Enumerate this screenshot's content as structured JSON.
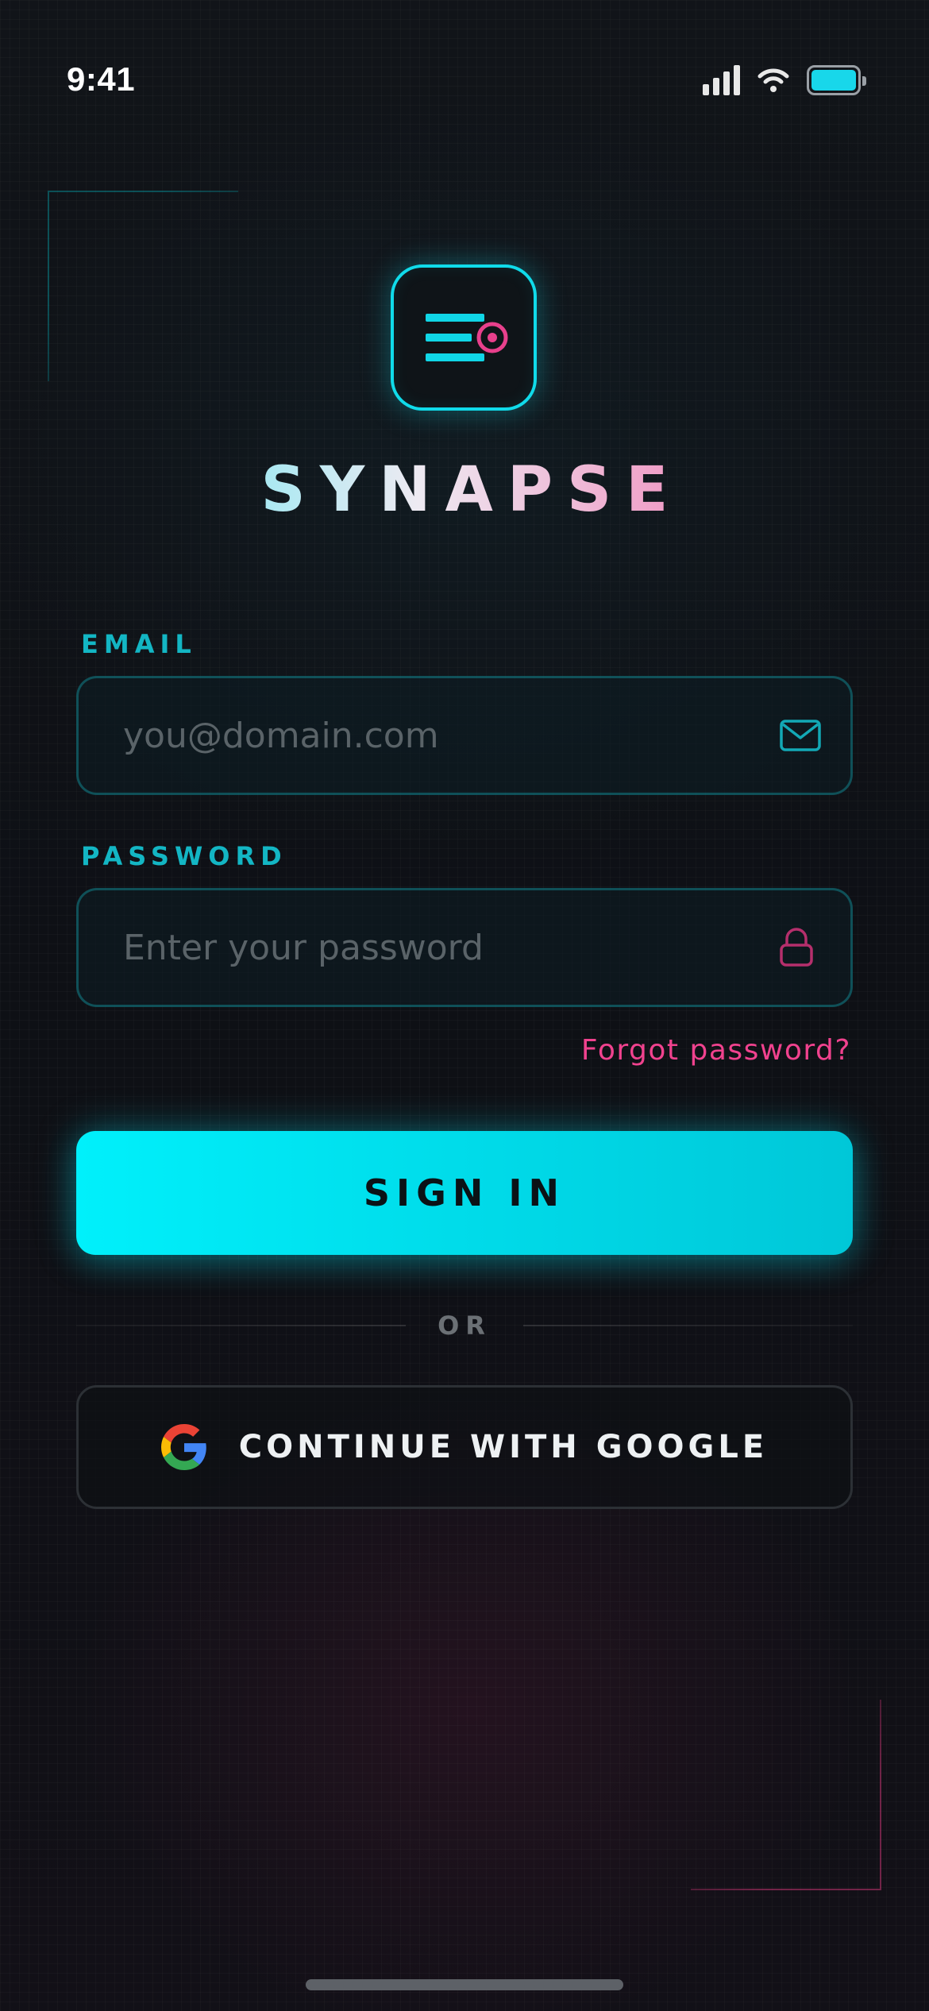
{
  "status_bar": {
    "time": "9:41",
    "icons": [
      "signal-icon",
      "wifi-icon",
      "battery-icon"
    ],
    "battery_color": "#18d7ea"
  },
  "brand": {
    "logo_icon": "menu-dot-logo-icon",
    "name": "SYNAPSE"
  },
  "form": {
    "email": {
      "label": "EMAIL",
      "placeholder": "you@domain.com",
      "value": "",
      "icon": "mail-icon"
    },
    "password": {
      "label": "PASSWORD",
      "placeholder": "Enter your password",
      "value": "",
      "icon": "lock-icon"
    },
    "forgot_link": "Forgot password?",
    "submit_label": "SIGN IN",
    "divider_text": "OR",
    "google_label": "CONTINUE WITH GOOGLE",
    "google_icon": "google-icon"
  },
  "colors": {
    "accent_cyan": "#00e6f4",
    "accent_pink": "#f0428e",
    "background": "#0d0f13"
  }
}
